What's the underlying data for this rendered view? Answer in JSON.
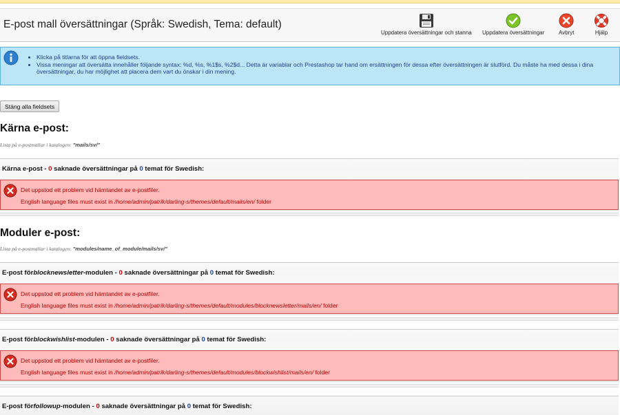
{
  "header": {
    "title": "E-post mall översättningar (Språk: Swedish, Tema: default)",
    "buttons": {
      "save_stay": "Uppdatera översättningar och stanna",
      "save": "Uppdatera översättningar",
      "cancel": "Avbryt",
      "help": "Hjälp"
    }
  },
  "info": {
    "items": [
      "Klicka på titlarna för att öppna fieldsets.",
      "Vissa meningar att översätta innehåller följande syntax: %d, %s, %1$s, %2$d... Detta är variablar och Prestashop tar hand om ersättningen för dessa efter översättningen är slutförd. Du måste ha med dessa i dina översättningar, du har möjlighet att placera dem vart du önskar i din mening."
    ]
  },
  "close_all_label": "Stäng alla fieldsets",
  "core": {
    "title": "Kärna e-post:",
    "desc_prefix": "Lista på e-postmallar i katalogen: ",
    "desc_path": "\"mails/sv/\"",
    "fieldset": {
      "prefix": "Kärna e-post - ",
      "missing": "0",
      "middle": " saknade översättningar på ",
      "theme_count": "0",
      "suffix": " temat för Swedish:",
      "error_title": "Det uppstod ett problem vid hämtandet av e-postfiler.",
      "error_prefix": "English language files must exist in ",
      "error_path": "/home/admin/patrik/darling-s/themes/default/mails/en/",
      "error_suffix": " folder"
    }
  },
  "modules": {
    "title": "Moduler e-post:",
    "desc_prefix": "Lista på e-postmallar i katalogen: ",
    "desc_path": "\"modules/name_of_module/mails/sv/\"",
    "fieldsets": [
      {
        "prefix": "E-post för",
        "module": "blocknewsletter",
        "module_suffix": "-modulen - ",
        "missing": "0",
        "middle": " saknade översättningar på ",
        "theme_count": "0",
        "suffix": " temat för Swedish:",
        "error_title": "Det uppstod ett problem vid hämtandet av e-postfiler.",
        "error_prefix": "English language files must exist in ",
        "error_path": "/home/admin/patrik/darling-s/themes/default/modules/blocknewsletter/mails/en/",
        "error_suffix": " folder"
      },
      {
        "prefix": "E-post för",
        "module": "blockwishlist",
        "module_suffix": "-modulen - ",
        "missing": "0",
        "middle": " saknade översättningar på ",
        "theme_count": "0",
        "suffix": " temat för Swedish:",
        "error_title": "Det uppstod ett problem vid hämtandet av e-postfiler.",
        "error_prefix": "English language files must exist in ",
        "error_path": "/home/admin/patrik/darling-s/themes/default/modules/blockwishlist/mails/en/",
        "error_suffix": " folder"
      },
      {
        "prefix": "E-post för",
        "module": "followup",
        "module_suffix": "-modulen - ",
        "missing": "0",
        "middle": " saknade översättningar på ",
        "theme_count": "0",
        "suffix": " temat för Swedish:"
      }
    ]
  },
  "icons": {
    "save_stay": "floppy-disk-icon",
    "save": "checkmark-icon",
    "cancel": "cancel-x-icon",
    "help": "lifebuoy-icon",
    "info": "info-icon",
    "error": "error-x-icon"
  },
  "colors": {
    "info_bg": "#bde5f8",
    "error_bg": "#ffbaba",
    "error_text": "#bb0000",
    "missing_count": "#cc0000",
    "theme_count": "#1e3f9e"
  }
}
